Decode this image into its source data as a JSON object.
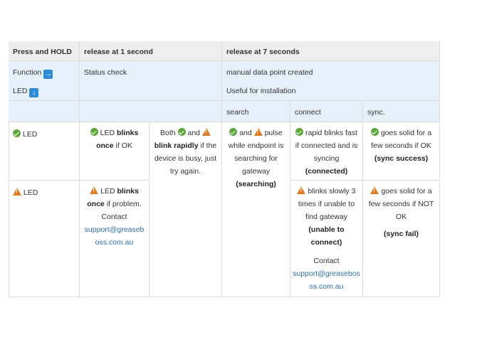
{
  "headers": {
    "col1": "Press and HOLD",
    "col2": "release at 1 second",
    "col3": "release at 7 seconds"
  },
  "row_function": {
    "label": "Function",
    "icon_function": "arrow-right-icon",
    "led_label": "LED",
    "icon_led": "arrow-down-icon",
    "status": "Status check",
    "manual": "manual data point created",
    "useful": "Useful for installation"
  },
  "sub_headers": {
    "search": "search",
    "connect": "connect",
    "sync": "sync."
  },
  "row_ok": {
    "label": "LED",
    "c1": {
      "l1a": "LED",
      "l1b": "blinks",
      "l2a": "once",
      "l2b": "if OK"
    },
    "c2": {
      "l1a": "Both",
      "l1b": "and",
      "l2a": "blink rapidly",
      "l2b": "if the",
      "l3": "device is busy, just",
      "l4": "try again."
    },
    "search": {
      "l1a": "and",
      "l1b": "pulse",
      "l2": "while endpoint is",
      "l3": "searching for",
      "l4": "gateway",
      "l5": "(searching)"
    },
    "connect": {
      "l1": "rapid blinks fast",
      "l2": "if connected and is",
      "l3": "syncing",
      "l4": "(connected)"
    },
    "sync": {
      "l1": "goes solid for a",
      "l2": "few seconds if OK",
      "l3": "(sync success)"
    }
  },
  "row_warn": {
    "label": "LED",
    "c1": {
      "l1a": "LED",
      "l1b": "blinks",
      "l2a": "once",
      "l2b": "if problem.",
      "l3": "Contact",
      "l4": "support@greaseb",
      "l5": "oss.com.au"
    },
    "connect": {
      "l1": "blinks slowly 3",
      "l2": "times if unable to",
      "l3": "find gateway",
      "l4": "(unable to",
      "l5": "connect)",
      "l6": "Contact",
      "l7": "support@greasebos",
      "l8": "ss.com.au"
    },
    "sync": {
      "l1": "goes solid for a",
      "l2": "few seconds if NOT",
      "l3": "OK",
      "l4": "(sync fail)"
    }
  },
  "colors": {
    "header_bg": "#eeeeee",
    "function_row_bg": "#e6f0fb",
    "ok_green": "#5aa53a",
    "warn_orange": "#e07a21",
    "link_blue": "#2f6fa6"
  }
}
